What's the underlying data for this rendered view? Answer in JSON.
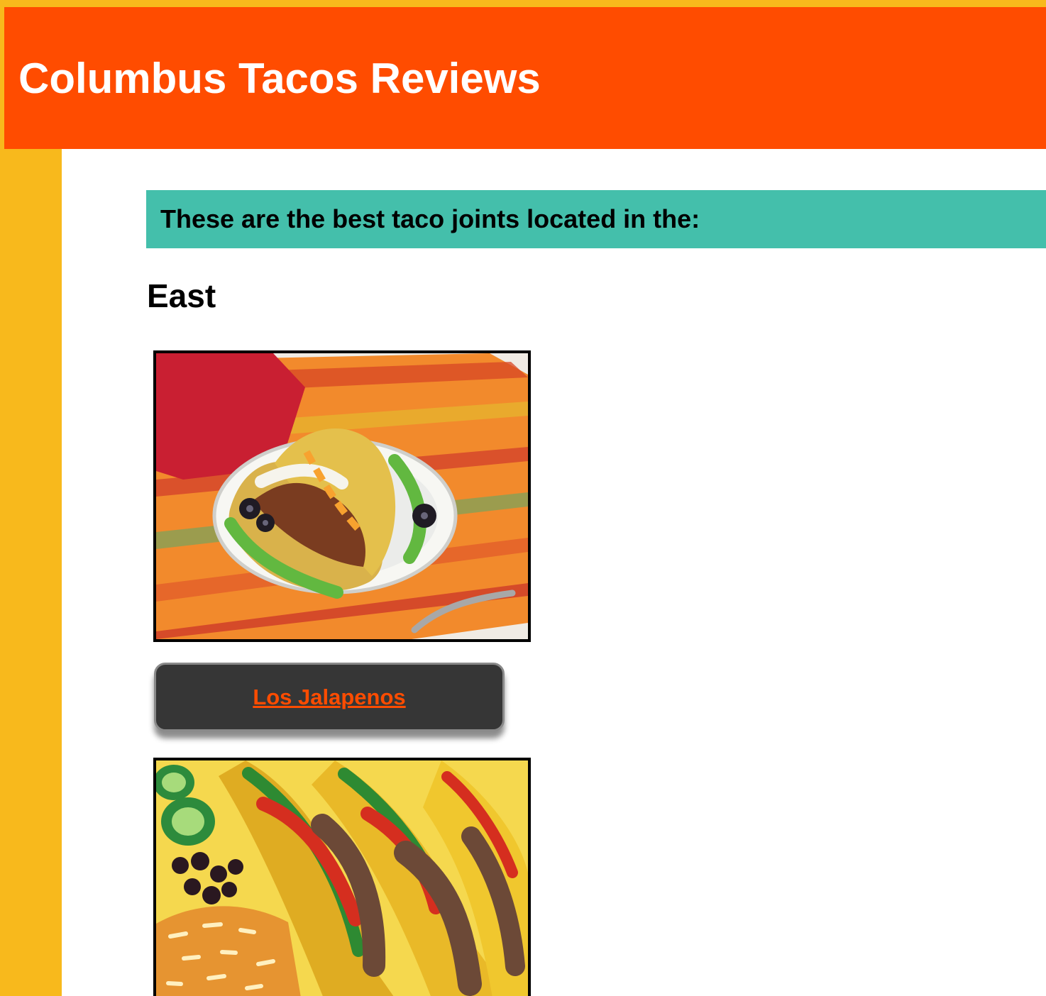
{
  "header": {
    "title": "Columbus Tacos Reviews"
  },
  "banner": {
    "text": "These are the best taco joints located in the:"
  },
  "region": {
    "heading": "East"
  },
  "restaurants": [
    {
      "name": "Los Jalapenos",
      "image": "taco-plate-photo"
    },
    {
      "image": "tacos-rice-beans-photo"
    }
  ],
  "colors": {
    "page_background": "#f8b91c",
    "header_background": "#ff4c00",
    "banner_background": "#44bfab",
    "content_background": "#ffffff",
    "link_card_background": "#363636",
    "link_color": "#ff4c00"
  }
}
